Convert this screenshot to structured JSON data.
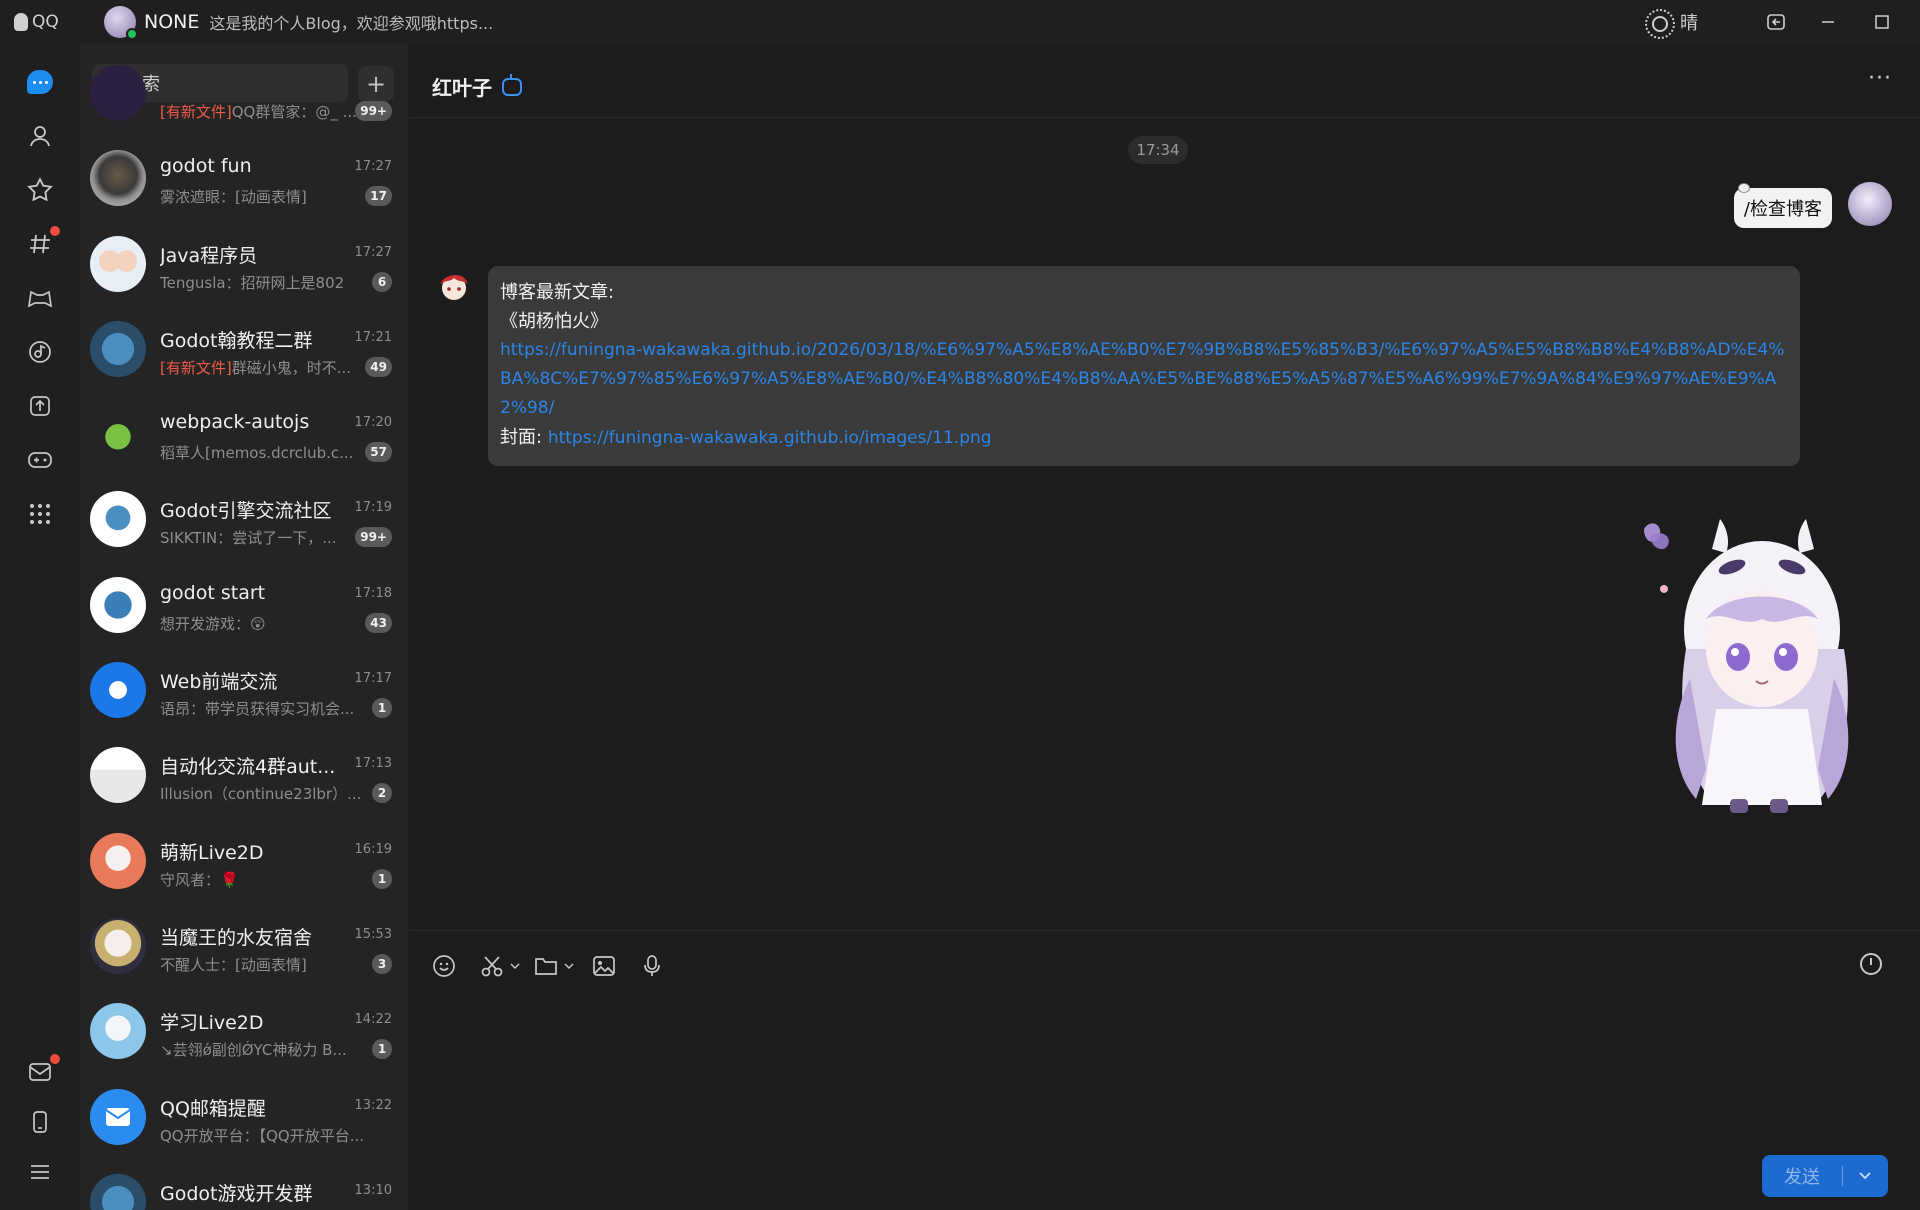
{
  "app": {
    "logo_text": "QQ"
  },
  "user": {
    "name": "NONE",
    "signature": "这是我的个人Blog，欢迎参观哦https..."
  },
  "weather": {
    "text": "晴"
  },
  "search": {
    "placeholder": "搜索"
  },
  "conversations": [
    {
      "name": "",
      "time": "",
      "preview_tag": "[有新文件]",
      "preview": "QQ群管家：@_ ...",
      "badge": "99+"
    },
    {
      "name": "godot fun",
      "time": "17:27",
      "preview_tag": "",
      "preview": "雾浓遮眼：[动画表情]",
      "badge": "17"
    },
    {
      "name": "Java程序员",
      "time": "17:27",
      "preview_tag": "",
      "preview": "Tengusla：招研网上是802",
      "badge": "6"
    },
    {
      "name": "Godot翰教程二群",
      "time": "17:21",
      "preview_tag": "[有新文件]",
      "preview": "群磁小鬼，时不...",
      "badge": "49"
    },
    {
      "name": "webpack-autojs",
      "time": "17:20",
      "preview_tag": "",
      "preview": "稻草人[memos.dcrclub.c...",
      "badge": "57"
    },
    {
      "name": "Godot引擎交流社区",
      "time": "17:19",
      "preview_tag": "",
      "preview": "SIKKTIN：尝试了一下，...",
      "badge": "99+"
    },
    {
      "name": "godot start",
      "time": "17:18",
      "preview_tag": "",
      "preview": "想开发游戏：😲",
      "badge": "43"
    },
    {
      "name": "Web前端交流",
      "time": "17:17",
      "preview_tag": "",
      "preview": "语昂：带学员获得实习机会...",
      "badge": "1"
    },
    {
      "name": "自动化交流4群aut...",
      "time": "17:13",
      "preview_tag": "",
      "preview": "Illusion（continue23lbr）...",
      "badge": "2"
    },
    {
      "name": "萌新Live2D",
      "time": "16:19",
      "preview_tag": "",
      "preview": "守风者：🌹",
      "badge": "1"
    },
    {
      "name": "当魔王的水友宿舍",
      "time": "15:53",
      "preview_tag": "",
      "preview": "不醒人士：[动画表情]",
      "badge": "3"
    },
    {
      "name": "学习Live2D",
      "time": "14:22",
      "preview_tag": "",
      "preview": "↘芸翎ǿ副创ǾYC神秘力 B...",
      "badge": "1"
    },
    {
      "name": "QQ邮箱提醒",
      "time": "13:22",
      "preview_tag": "",
      "preview": "QQ开放平台：【QQ开放平台...",
      "badge": ""
    },
    {
      "name": "Godot游戏开发群",
      "time": "13:10",
      "preview_tag": "",
      "preview": "",
      "badge": ""
    }
  ],
  "chat": {
    "title": "红叶子",
    "time_divider": "17:34",
    "my_message": "/检查博客",
    "bot_message": {
      "line1": "博客最新文章:",
      "line2": "《胡杨怕火》",
      "link1": "https://funingna-wakawaka.github.io/2026/03/18/%E6%97%A5%E8%AE%B0%E7%9B%B8%E5%85%B3/%E6%97%A5%E5%B8%B8%E4%B8%AD%E4%BA%8C%E7%97%85%E6%97%A5%E8%AE%B0/%E4%B8%80%E4%B8%AA%E5%BE%88%E5%A5%87%E5%A6%99%E7%9A%84%E9%97%AE%E9%A2%98/",
      "cover_label": "封面:",
      "cover_link": "https://funingna-wakawaka.github.io/images/11.png"
    }
  },
  "composer": {
    "send_label": "发送"
  },
  "colors": {
    "accent": "#1d8cf0",
    "unread_dot": "#f04b3e",
    "link": "#2b86e8"
  }
}
